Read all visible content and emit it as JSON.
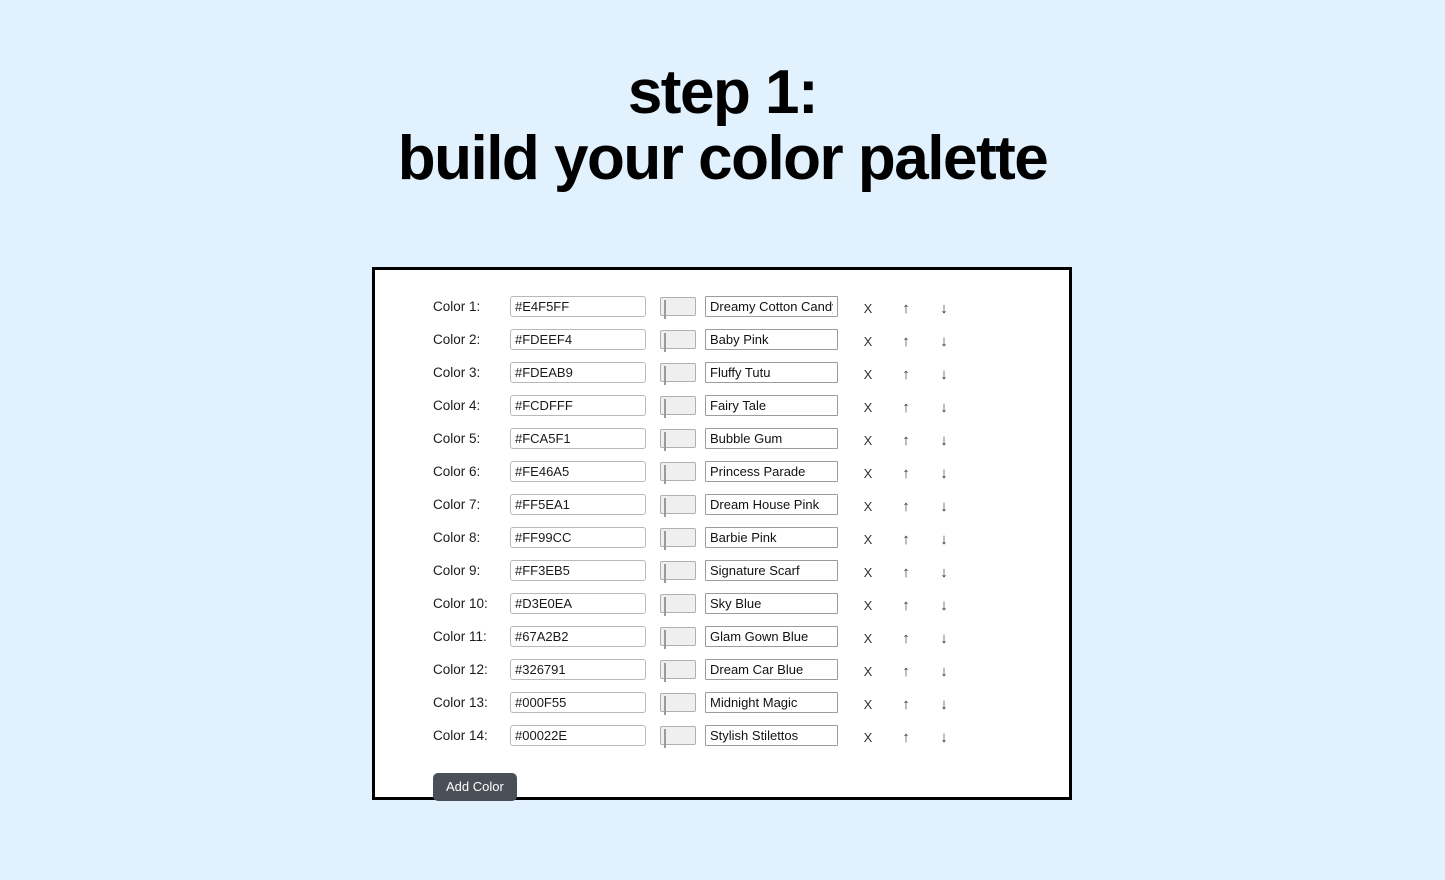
{
  "page": {
    "background_color": "#E1F1FD"
  },
  "title": {
    "line1": "step 1:",
    "line2": "build your color palette"
  },
  "card": {
    "border_color": "#000000",
    "background_color": "#FFFFFF"
  },
  "controls": {
    "remove_label": "X",
    "move_up_label": "↑",
    "move_down_label": "↓",
    "add_color_label": "Add Color",
    "add_color_background": "#4A4F58"
  },
  "rows": [
    {
      "label": "Color 1:",
      "hex": "#E4F5FF",
      "name": "Dreamy Cotton Candy"
    },
    {
      "label": "Color 2:",
      "hex": "#FDEEF4",
      "name": "Baby Pink"
    },
    {
      "label": "Color 3:",
      "hex": "#FDEAB9",
      "name": "Fluffy Tutu"
    },
    {
      "label": "Color 4:",
      "hex": "#FCDFFF",
      "name": "Fairy Tale"
    },
    {
      "label": "Color 5:",
      "hex": "#FCA5F1",
      "name": "Bubble Gum"
    },
    {
      "label": "Color 6:",
      "hex": "#FE46A5",
      "name": "Princess Parade"
    },
    {
      "label": "Color 7:",
      "hex": "#FF5EA1",
      "name": "Dream House Pink"
    },
    {
      "label": "Color 8:",
      "hex": "#FF99CC",
      "name": "Barbie Pink"
    },
    {
      "label": "Color 9:",
      "hex": "#FF3EB5",
      "name": "Signature Scarf"
    },
    {
      "label": "Color 10:",
      "hex": "#D3E0EA",
      "name": "Sky Blue"
    },
    {
      "label": "Color 11:",
      "hex": "#67A2B2",
      "name": "Glam Gown Blue"
    },
    {
      "label": "Color 12:",
      "hex": "#326791",
      "name": "Dream Car Blue"
    },
    {
      "label": "Color 13:",
      "hex": "#000F55",
      "name": "Midnight Magic"
    },
    {
      "label": "Color 14:",
      "hex": "#00022E",
      "name": "Stylish Stilettos"
    }
  ]
}
